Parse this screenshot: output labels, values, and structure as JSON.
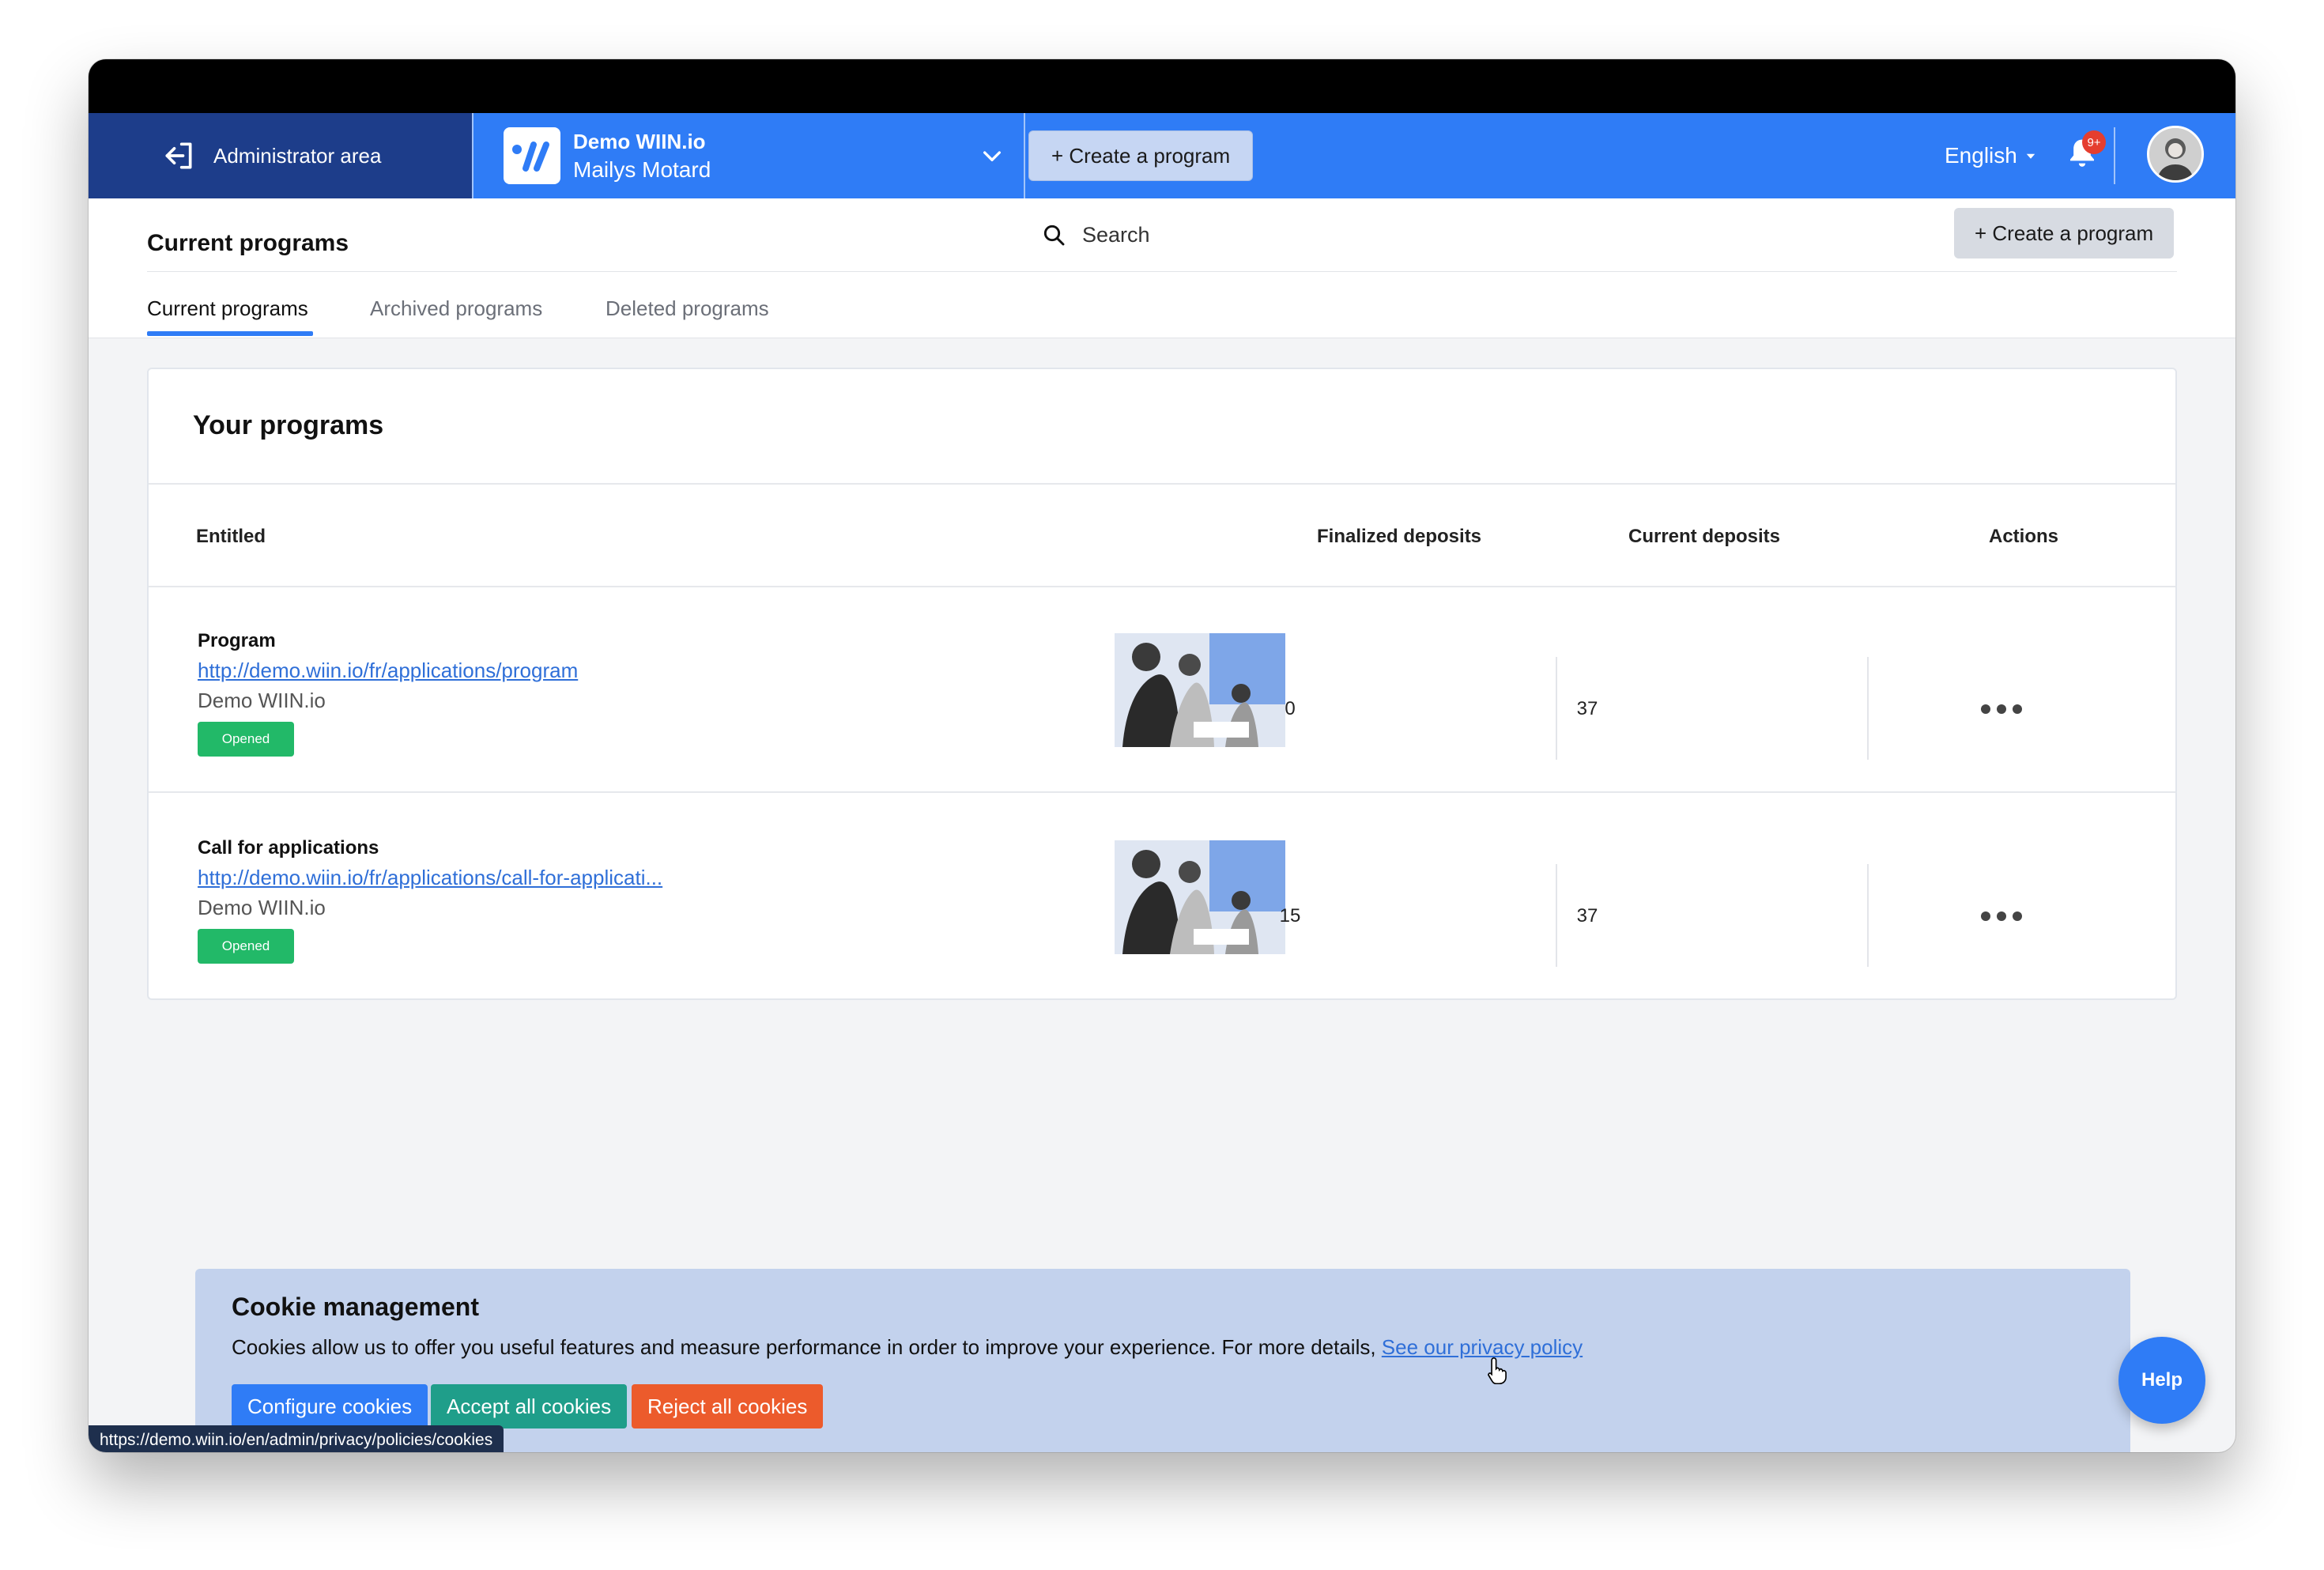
{
  "navbar": {
    "admin_label": "Administrator area",
    "org_name": "Demo WIIN.io",
    "org_user": "Mailys Motard",
    "create_label": "+ Create a program",
    "language": "English",
    "notification_badge": "9+"
  },
  "header": {
    "title": "Current programs",
    "search_label": "Search",
    "create_label": "+ Create a program",
    "tabs": [
      {
        "label": "Current programs",
        "active": true
      },
      {
        "label": "Archived programs",
        "active": false
      },
      {
        "label": "Deleted programs",
        "active": false
      }
    ]
  },
  "programs": {
    "title": "Your programs",
    "columns": {
      "entitled": "Entitled",
      "finalized": "Finalized deposits",
      "current": "Current deposits",
      "actions": "Actions"
    },
    "rows": [
      {
        "title": "Program",
        "link": "http://demo.wiin.io/fr/applications/program",
        "org": "Demo WIIN.io",
        "status": "Opened",
        "finalized": "0",
        "current": "37"
      },
      {
        "title": "Call for applications",
        "link": "http://demo.wiin.io/fr/applications/call-for-applicati...",
        "org": "Demo WIIN.io",
        "status": "Opened",
        "finalized": "15",
        "current": "37"
      }
    ]
  },
  "cookie": {
    "title": "Cookie management",
    "text": "Cookies allow us to offer you useful features and measure performance in order to improve your experience. For more details, ",
    "link": "See our privacy policy",
    "configure": "Configure cookies",
    "accept": "Accept all cookies",
    "reject": "Reject all cookies"
  },
  "help_label": "Help",
  "status_url": "https://demo.wiin.io/en/admin/privacy/policies/cookies",
  "colors": {
    "primary": "#2f7cf6",
    "admin_bg": "#1d3d8a",
    "success": "#22b968",
    "accept": "#1f9e8a",
    "reject": "#ec5b2c",
    "cookie_bg": "#c3d2ed"
  }
}
